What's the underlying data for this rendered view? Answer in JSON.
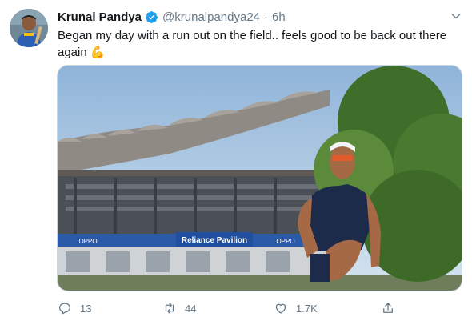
{
  "tweet": {
    "author_name": "Krunal Pandya",
    "verified_icon": "verified-badge-icon",
    "handle": "@krunalpandya24",
    "separator": "·",
    "time": "6h",
    "text_main": "Began my day with a run out on the field.. feels good to be back out there again",
    "text_emoji": "💪",
    "media": {
      "stadium_sign": "Reliance Pavilion",
      "sign_left": "OPPO",
      "sign_right": "OPPO"
    },
    "actions": {
      "replies": "13",
      "retweets": "44",
      "likes": "1.7K"
    },
    "colors": {
      "accent": "#1da1f2",
      "muted": "#657786",
      "text": "#14171a"
    }
  }
}
